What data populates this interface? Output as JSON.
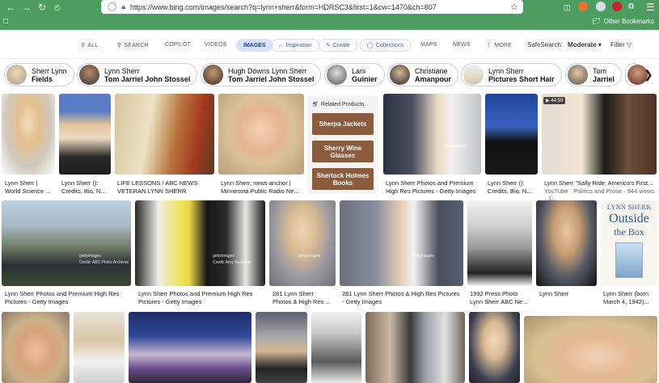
{
  "browser": {
    "url": "https://www.bing.com/images/search?q=lynn+sherr&form=HDRSC3&first=1&cw=1470&ch=807",
    "other_bookmarks": "Other Bookmarks"
  },
  "bing_nav": {
    "all": "ALL",
    "search": "SEARCH",
    "copilot": "COPILOT",
    "videos": "VIDEOS",
    "images": "IMAGES",
    "inspiration": "Inspiration",
    "create": "Create",
    "collections": "Collections",
    "maps": "MAPS",
    "news": "NEWS",
    "more": "MORE",
    "safesearch_label": "SafeSearch:",
    "safesearch_value": "Moderate",
    "filter": "Filter"
  },
  "related_searches": [
    {
      "line1": "Sherr Lynn",
      "line2": "Fields"
    },
    {
      "line1": "Lynn Sherr",
      "line2": "Tom Jarriel John Stossel"
    },
    {
      "line1": "Hugh Downs Lynn Sherr",
      "line2": "Tom Jarriel John Stossel"
    },
    {
      "line1": "Lani",
      "line2": "Guinier"
    },
    {
      "line1": "Christiane",
      "line2": "Amanpour"
    },
    {
      "line1": "Lynn Sherr",
      "line2": "Pictures Short Hair"
    },
    {
      "line1": "Tom",
      "line2": "Jarriel"
    }
  ],
  "related_products": {
    "header": "Related Products",
    "items": [
      "Sherpa Jackets",
      "Sherry Wine Glasses",
      "Sherlock Holmes Books"
    ]
  },
  "video_badge": "44:59",
  "images_row1": [
    {
      "cap1": "Lynn Sherr |",
      "cap2": "World Science ..."
    },
    {
      "cap1": "Lynn Sherr ():",
      "cap2": "Credits, Bio, N..."
    },
    {
      "cap1": "LIFE LESSONS / ABC NEWS",
      "cap2": "VETERAN LYNN SHERR"
    },
    {
      "cap1": "Lynn Sherr, news anchor |",
      "cap2": "Minnesota Public Radio Ne..."
    },
    {
      "cap1": "Lynn Sherr Photos and Premium",
      "cap2": "High Res Pictures - Getty Images"
    },
    {
      "cap1": "Lynn Sherr ():",
      "cap2": "Credits, Bio, N..."
    },
    {
      "cap1": "Lynn Sherr \"Sally Ride: America's First...",
      "cap2": "YouTube · Politics and Prose · 944 views · J..."
    }
  ],
  "images_row2": [
    {
      "cap1": "Lynn Sherr Photos and Premium High Res",
      "cap2": "Pictures - Getty Images"
    },
    {
      "cap1": "Lynn Sherr Photos and Premium High Res",
      "cap2": "Pictures - Getty Images"
    },
    {
      "cap1": "281 Lynn Sherr",
      "cap2": "Photos & High Res ..."
    },
    {
      "cap1": "281 Lynn Sherr Photos & High Res Pictures",
      "cap2": "- Getty Images"
    },
    {
      "cap1": "1992 Press Photo",
      "cap2": "Lynn Sherr ABC Ne..."
    },
    {
      "cap1": "Lynn Sherr",
      "cap2": ""
    },
    {
      "cap1": "Lynn Sherr (born",
      "cap2": "March 4, 1942)..."
    }
  ],
  "watermarks": {
    "getty": "gettyimages",
    "credit": "Credit: Amy Sussman",
    "credit_abc": "Credit: ABC Photo Archives"
  },
  "book": {
    "author": "LYNN SHERR",
    "title1": "Outside",
    "title2": "the Box"
  }
}
